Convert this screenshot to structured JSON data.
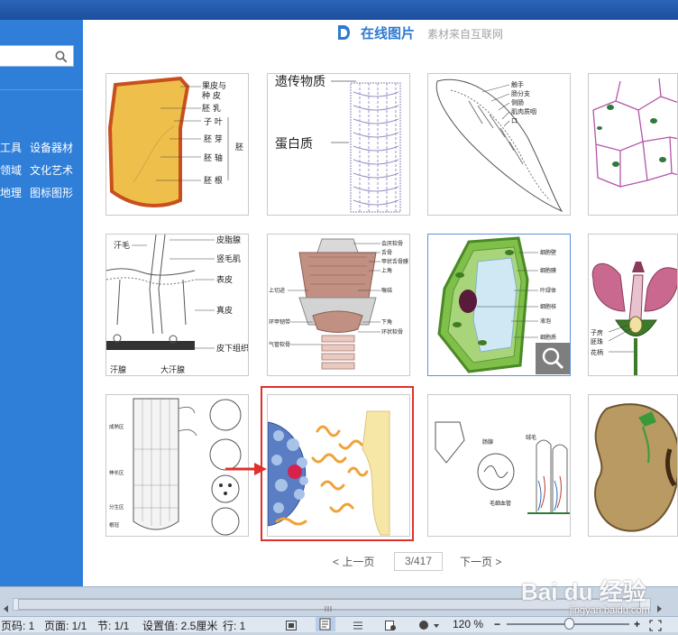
{
  "sidebar": {
    "search_placeholder": "",
    "categories": [
      {
        "label": "工具"
      },
      {
        "label": "设备器材"
      },
      {
        "label": "领域"
      },
      {
        "label": "文化艺术"
      },
      {
        "label": "地理"
      },
      {
        "label": "图标图形"
      }
    ]
  },
  "panel": {
    "title": "在线图片",
    "subtitle": "素材来自互联网"
  },
  "thumbnails": {
    "t1": {
      "l1": "果皮与",
      "l2": "种  皮",
      "l3": "胚  乳",
      "l4": "子  叶",
      "l5": "胚  芽",
      "l6": "胚  轴",
      "l7": "胚  根",
      "l8": "胚"
    },
    "t2": {
      "l1": "遗传物质",
      "l2": "蛋白质"
    },
    "t3": {
      "l1": "触手",
      "l2": "肠分支",
      "l3": "侧肠",
      "l4": "肌肉质咽",
      "l5": "口"
    },
    "t5": {
      "l1": "汗毛",
      "l2": "皮脂腺",
      "l3": "竖毛肌",
      "l4": "表皮",
      "l5": "真皮",
      "l6": "皮下组织",
      "l7": "汗腺",
      "l8": "大汗腺"
    },
    "t6": {
      "l1": "会厌软骨",
      "l2": "舌骨",
      "l3": "甲状舌骨膜",
      "l4": "上角",
      "l5": "上切迹",
      "l6": "喉结",
      "l7": "环甲韧带",
      "l8": "下角",
      "l9": "环状软骨",
      "l10": "气管软骨"
    },
    "t7": {
      "l1": "细胞壁",
      "l2": "细胞膜",
      "l3": "叶绿体",
      "l4": "细胞核",
      "l5": "液泡",
      "l6": "细胞质"
    },
    "t8": {
      "l1": "子房",
      "l2": "胚珠",
      "l3": "花柄"
    },
    "t9": {
      "l1": "成熟区",
      "l2": "伸长区",
      "l3": "分生区",
      "l4": "根冠"
    },
    "t11": {
      "l1": "绒毛",
      "l2": "肠腺",
      "l3": "毛细血管"
    }
  },
  "pager": {
    "prev": "< 上一页",
    "page": "3/417",
    "next": "下一页 >"
  },
  "statusbar": {
    "page_code": "页码: 1",
    "page": "页面: 1/1",
    "section": "节: 1/1",
    "setting": "设置值: 2.5厘米",
    "row": "行: 1",
    "zoom": "120 %"
  },
  "watermark": {
    "main": "Bai du 经验",
    "url": "jingyan.baidu.com"
  },
  "colors": {
    "sidebar": "#2f7fd9",
    "accent": "#2e7ad0",
    "highlight": "#e0302c"
  }
}
